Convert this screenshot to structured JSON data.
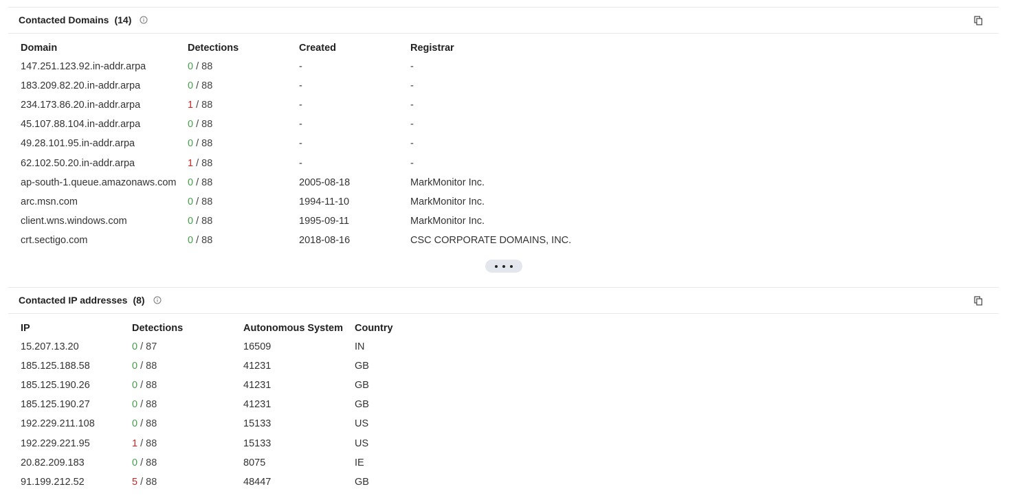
{
  "domains_section": {
    "title": "Contacted Domains",
    "count": "(14)",
    "columns": [
      "Domain",
      "Detections",
      "Created",
      "Registrar"
    ],
    "rows": [
      {
        "domain": "147.251.123.92.in-addr.arpa",
        "det": "0",
        "total": "/ 88",
        "created": "-",
        "registrar": "-"
      },
      {
        "domain": "183.209.82.20.in-addr.arpa",
        "det": "0",
        "total": "/ 88",
        "created": "-",
        "registrar": "-"
      },
      {
        "domain": "234.173.86.20.in-addr.arpa",
        "det": "1",
        "total": "/ 88",
        "created": "-",
        "registrar": "-"
      },
      {
        "domain": "45.107.88.104.in-addr.arpa",
        "det": "0",
        "total": "/ 88",
        "created": "-",
        "registrar": "-"
      },
      {
        "domain": "49.28.101.95.in-addr.arpa",
        "det": "0",
        "total": "/ 88",
        "created": "-",
        "registrar": "-"
      },
      {
        "domain": "62.102.50.20.in-addr.arpa",
        "det": "1",
        "total": "/ 88",
        "created": "-",
        "registrar": "-"
      },
      {
        "domain": "ap-south-1.queue.amazonaws.com",
        "det": "0",
        "total": "/ 88",
        "created": "2005-08-18",
        "registrar": "MarkMonitor Inc."
      },
      {
        "domain": "arc.msn.com",
        "det": "0",
        "total": "/ 88",
        "created": "1994-11-10",
        "registrar": "MarkMonitor Inc."
      },
      {
        "domain": "client.wns.windows.com",
        "det": "0",
        "total": "/ 88",
        "created": "1995-09-11",
        "registrar": "MarkMonitor Inc."
      },
      {
        "domain": "crt.sectigo.com",
        "det": "0",
        "total": "/ 88",
        "created": "2018-08-16",
        "registrar": "CSC CORPORATE DOMAINS, INC."
      }
    ]
  },
  "ips_section": {
    "title": "Contacted IP addresses",
    "count": "(8)",
    "columns": [
      "IP",
      "Detections",
      "Autonomous System",
      "Country"
    ],
    "rows": [
      {
        "ip": "15.207.13.20",
        "det": "0",
        "total": "/ 87",
        "as": "16509",
        "country": "IN"
      },
      {
        "ip": "185.125.188.58",
        "det": "0",
        "total": "/ 88",
        "as": "41231",
        "country": "GB"
      },
      {
        "ip": "185.125.190.26",
        "det": "0",
        "total": "/ 88",
        "as": "41231",
        "country": "GB"
      },
      {
        "ip": "185.125.190.27",
        "det": "0",
        "total": "/ 88",
        "as": "41231",
        "country": "GB"
      },
      {
        "ip": "192.229.211.108",
        "det": "0",
        "total": "/ 88",
        "as": "15133",
        "country": "US"
      },
      {
        "ip": "192.229.221.95",
        "det": "1",
        "total": "/ 88",
        "as": "15133",
        "country": "US"
      },
      {
        "ip": "20.82.209.183",
        "det": "0",
        "total": "/ 88",
        "as": "8075",
        "country": "IE"
      },
      {
        "ip": "91.199.212.52",
        "det": "5",
        "total": "/ 88",
        "as": "48447",
        "country": "GB"
      }
    ]
  },
  "icons": {
    "info": "info-circle-icon",
    "copy": "copy-icon",
    "more": "ellipsis-icon"
  },
  "colors": {
    "clean": "#43a047",
    "malicious": "#c62828",
    "border": "#e6e8ec",
    "more_button_bg": "#e3e7ed"
  }
}
